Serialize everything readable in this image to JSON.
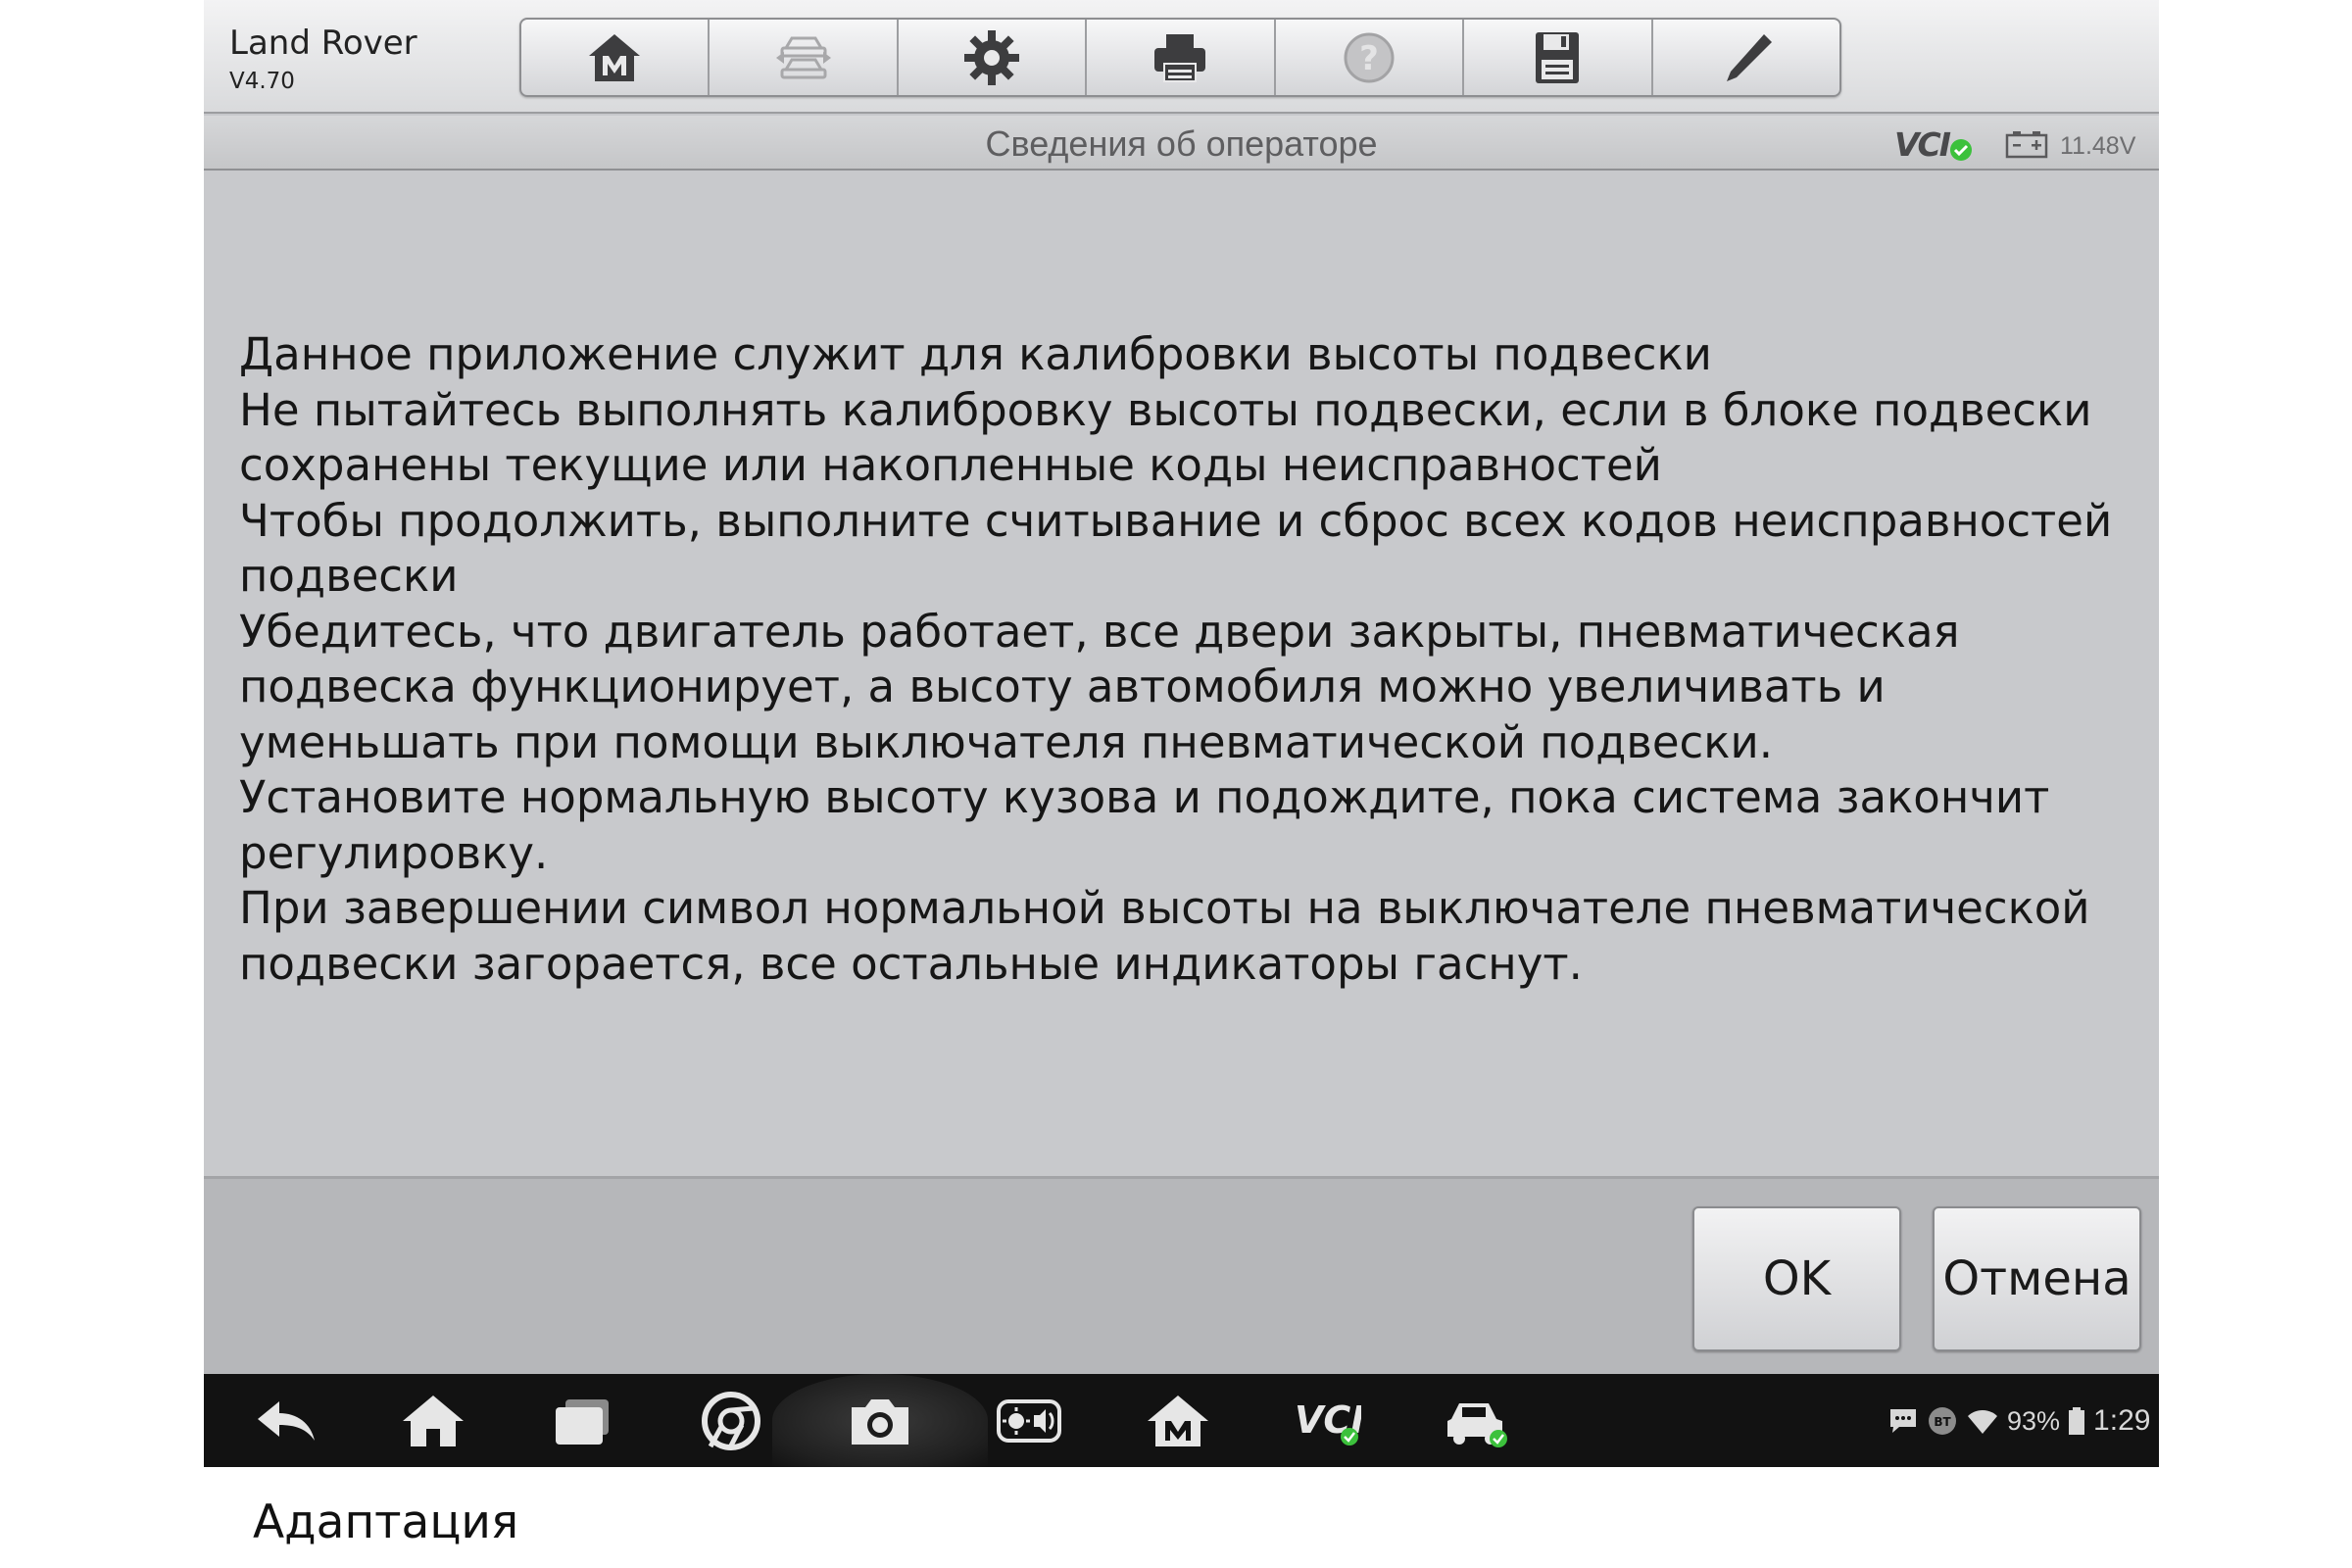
{
  "header": {
    "app_title": "Land Rover",
    "app_version": "V4.70",
    "toolbar": [
      {
        "name": "home-m-button",
        "icon": "home-m-icon"
      },
      {
        "name": "vehicle-swap-button",
        "icon": "car-swap-icon",
        "disabled": true
      },
      {
        "name": "settings-button",
        "icon": "gear-icon"
      },
      {
        "name": "print-button",
        "icon": "printer-icon"
      },
      {
        "name": "help-button",
        "icon": "help-icon",
        "disabled": true
      },
      {
        "name": "save-button",
        "icon": "floppy-disk-icon"
      },
      {
        "name": "edit-button",
        "icon": "pencil-icon"
      }
    ]
  },
  "subheader": {
    "title": "Сведения об операторе",
    "vci_label": "VCI",
    "battery_voltage": "11.48V"
  },
  "message": {
    "lines": [
      "Данное приложение служит для калибровки высоты подвески",
      "Не пытайтесь выполнять калибровку высоты подвески, если в блоке подвески сохранены текущие или накопленные коды неисправностей",
      "Чтобы продолжить, выполните считывание и сброс всех кодов неисправностей подвески",
      "Убедитесь, что двигатель работает, все двери закрыты, пневматическая подвеска функционирует, а высоту автомобиля можно увеличивать и уменьшать при помощи выключателя пневматической подвески.",
      "Установите нормальную высоту кузова и подождите, пока система закончит регулировку.",
      "При завершении символ нормальной высоты на выключателе пневматической подвески загорается, все остальные индикаторы гаснут."
    ]
  },
  "footer": {
    "ok_label": "OK",
    "cancel_label": "Отмена"
  },
  "navbar": {
    "buttons": [
      "back-icon",
      "home-icon",
      "recent-apps-icon",
      "chrome-icon",
      "camera-icon",
      "brightness-volume-icon",
      "home-m-icon",
      "vci-icon",
      "car-connected-icon"
    ],
    "vci_label": "VCI",
    "battery_percent": "93%",
    "time": "1:29",
    "bt_label": "BT"
  },
  "caption": "Адаптация",
  "colors": {
    "background": "#c7c8cb",
    "navbar": "#121212",
    "status_green": "#3cc13c"
  }
}
